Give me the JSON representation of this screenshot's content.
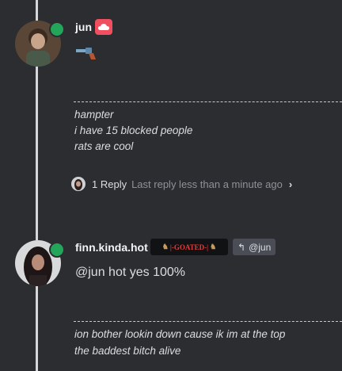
{
  "message1": {
    "username": "jun",
    "badge_icon": "cloud-icon",
    "content_icon": "revolver-icon",
    "bio_title": "hampter",
    "bio_lines": [
      "i have 15 blocked people",
      "rats are cool"
    ],
    "thread": {
      "reply_count": "1 Reply",
      "last_reply": "Last reply less than a minute ago",
      "chevron": "›"
    }
  },
  "message2": {
    "username": "finn.kinda.hot",
    "badge_text": "|-GOATED-|",
    "reply_to": "@jun",
    "message": "@jun hot yes 100%",
    "bio_lines": [
      "ion bother lookin down cause ik im at the top",
      "the baddest bitch alive"
    ]
  },
  "colors": {
    "background": "#2b2d31",
    "online": "#23a55a",
    "badge_red": "#ef4f5e",
    "goated_red": "#e23b3b"
  }
}
